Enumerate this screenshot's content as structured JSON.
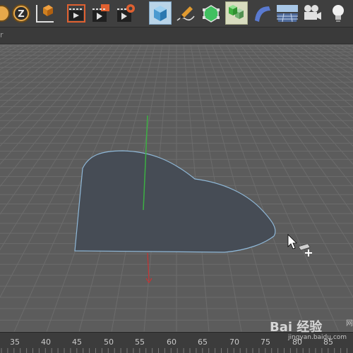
{
  "toolbar": {
    "items": [
      {
        "name": "cursor-icon"
      },
      {
        "name": "z-axis-lock-icon"
      },
      {
        "name": "world-coordinate-icon"
      },
      {
        "name": "render-region-icon"
      },
      {
        "name": "render-view-icon"
      },
      {
        "name": "render-settings-icon"
      },
      {
        "name": "cube-primitive-icon"
      },
      {
        "name": "pen-spline-icon"
      },
      {
        "name": "subdivision-surface-icon"
      },
      {
        "name": "array-cloner-icon"
      },
      {
        "name": "deformer-bend-icon"
      },
      {
        "name": "floor-environment-icon"
      },
      {
        "name": "camera-icon"
      },
      {
        "name": "light-icon"
      }
    ]
  },
  "subbar": {
    "label": "r"
  },
  "timeline": {
    "ticks": [
      "35",
      "40",
      "45",
      "50",
      "55",
      "60",
      "65",
      "70",
      "75",
      "80",
      "85"
    ]
  },
  "watermark": {
    "text": "Bai 经验",
    "sub": "jingyan.baidu.com",
    "side": "网"
  },
  "colors": {
    "toolbar_bg": "#3f3f3f",
    "viewport_bg": "#5c5c5c",
    "shape_fill": "#464c55",
    "shape_outline": "#8fb8d8",
    "axis_y": "#3cb043",
    "axis_x": "#c83232"
  }
}
